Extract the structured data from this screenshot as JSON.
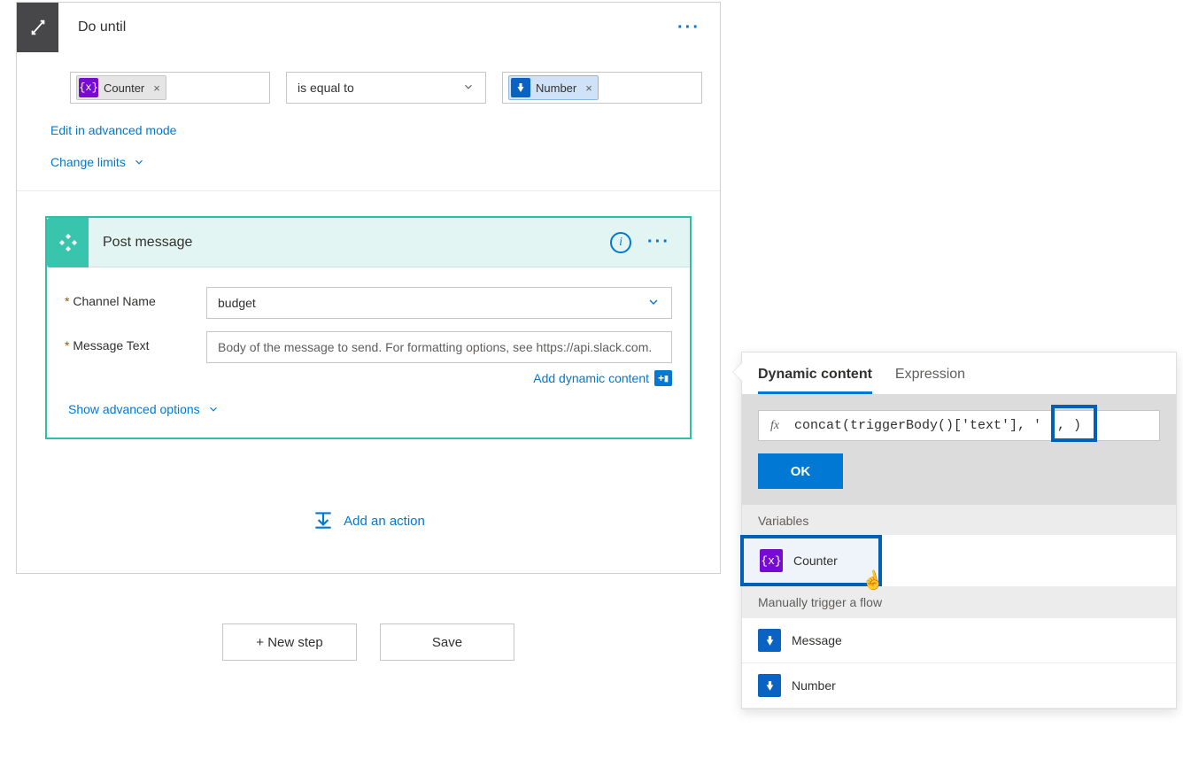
{
  "do_until": {
    "title": "Do until",
    "condition": {
      "left_token": {
        "label": "Counter"
      },
      "operator": "is equal to",
      "right_token": {
        "label": "Number"
      }
    },
    "edit_advanced": "Edit in advanced mode",
    "change_limits": "Change limits"
  },
  "post_message": {
    "title": "Post message",
    "channel_label": "Channel Name",
    "channel_value": "budget",
    "message_label": "Message Text",
    "message_placeholder": "Body of the message to send. For formatting options, see https://api.slack.com.",
    "add_dynamic": "Add dynamic content",
    "show_advanced": "Show advanced options"
  },
  "add_action": "Add an action",
  "buttons": {
    "new_step": "+ New step",
    "save": "Save"
  },
  "popout": {
    "tab_dynamic": "Dynamic content",
    "tab_expression": "Expression",
    "fx_label": "fx",
    "expression_text": "concat(triggerBody()['text'], ' ', )",
    "ok": "OK",
    "section_variables": "Variables",
    "item_counter": "Counter",
    "section_trigger": "Manually trigger a flow",
    "item_message": "Message",
    "item_number": "Number"
  },
  "colors": {
    "accent": "#0078d4",
    "var_purple": "#770bd4",
    "trigger_blue": "#0a63c2",
    "teal": "#38c4ad",
    "highlight": "#0060b8"
  }
}
